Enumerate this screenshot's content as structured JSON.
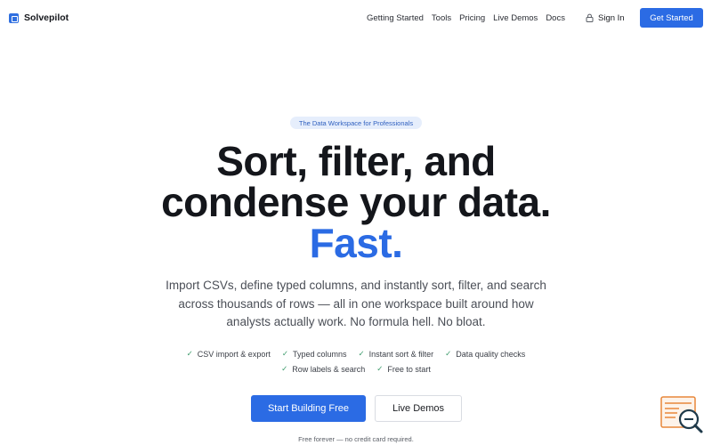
{
  "brand": {
    "name": "Solvepilot",
    "accent": "#2b6be4"
  },
  "nav": {
    "links": [
      "Getting Started",
      "Tools",
      "Pricing",
      "Live Demos",
      "Docs"
    ],
    "signin": "Sign In",
    "cta": "Get Started"
  },
  "hero": {
    "badge": "The Data Workspace for Professionals",
    "headline_line1": "Sort, filter, and",
    "headline_line2": "condense your data.",
    "headline_accent": "Fast.",
    "subtext": "Import CSVs, define typed columns, and instantly sort, filter, and search across thousands of rows — all in one workspace built around how analysts actually work. No formula hell. No bloat.",
    "features_row1": [
      "CSV import & export",
      "Typed columns",
      "Instant sort & filter",
      "Data quality checks"
    ],
    "features_row2": [
      "Row labels & search",
      "Free to start"
    ],
    "primary_button": "Start Building Free",
    "secondary_button": "Live Demos",
    "foot_note": "Free forever — no credit card required."
  },
  "widget": {
    "icon": "search-doc-icon"
  }
}
